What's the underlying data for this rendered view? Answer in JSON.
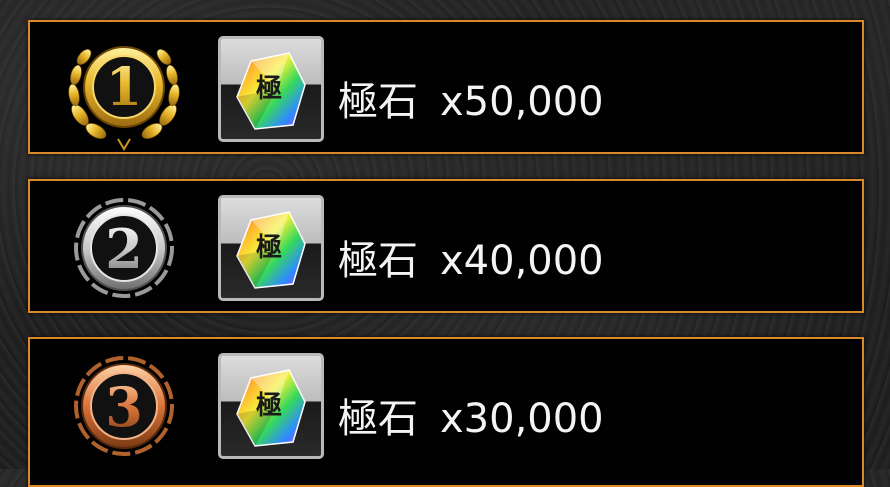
{
  "rewards": [
    {
      "rank": "1",
      "medal": "gold-laurel-medal-icon",
      "item_icon": "kiwame-stone-icon",
      "item_glyph": "極",
      "name": "極石",
      "amount": "x50,000"
    },
    {
      "rank": "2",
      "medal": "silver-medal-icon",
      "item_icon": "kiwame-stone-icon",
      "item_glyph": "極",
      "name": "極石",
      "amount": "x40,000"
    },
    {
      "rank": "3",
      "medal": "bronze-medal-icon",
      "item_icon": "kiwame-stone-icon",
      "item_glyph": "極",
      "name": "極石",
      "amount": "x30,000"
    }
  ],
  "colors": {
    "row_border": "#d88a2a",
    "gold": "#e8b72a",
    "silver": "#cfcfcf",
    "bronze": "#d9743a"
  }
}
